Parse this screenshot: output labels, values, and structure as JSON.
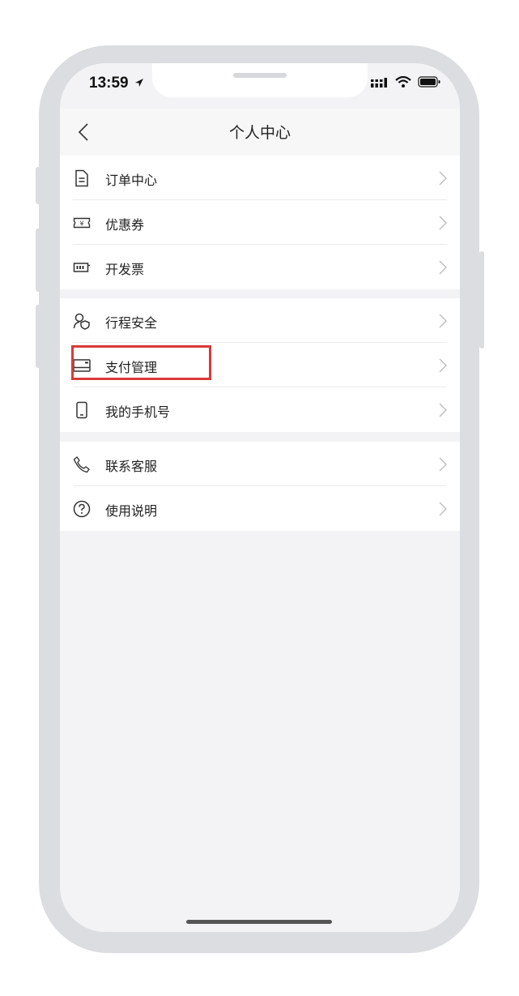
{
  "status_bar": {
    "time": "13:59"
  },
  "nav": {
    "title": "个人中心"
  },
  "groups": [
    {
      "items": [
        {
          "label": "订单中心",
          "icon": "document-icon"
        },
        {
          "label": "优惠券",
          "icon": "coupon-icon"
        },
        {
          "label": "开发票",
          "icon": "invoice-icon"
        }
      ]
    },
    {
      "items": [
        {
          "label": "行程安全",
          "icon": "safety-icon"
        },
        {
          "label": "支付管理",
          "icon": "card-icon",
          "highlighted": true
        },
        {
          "label": "我的手机号",
          "icon": "phone-icon"
        }
      ]
    },
    {
      "items": [
        {
          "label": "联系客服",
          "icon": "headset-phone-icon"
        },
        {
          "label": "使用说明",
          "icon": "help-icon"
        }
      ]
    }
  ],
  "colors": {
    "highlight": "#d83a3a",
    "background": "#f3f3f5"
  }
}
